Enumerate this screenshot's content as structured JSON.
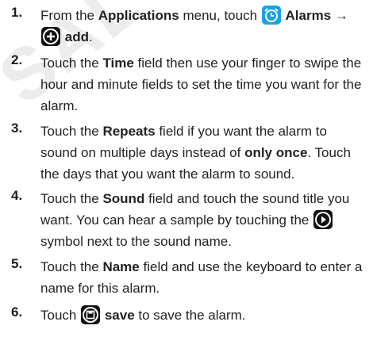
{
  "watermark": "SAL USE ON",
  "steps": [
    {
      "num": "1.",
      "parts": {
        "a": "From the ",
        "b": "Applications",
        "c": " menu, touch ",
        "d": "Alarms →",
        "e": "add",
        "f": "."
      }
    },
    {
      "num": "2.",
      "parts": {
        "a": "Touch the ",
        "b": "Time",
        "c": " field then use your finger to swipe the hour and minute fields to set the time you want for the alarm."
      }
    },
    {
      "num": "3.",
      "parts": {
        "a": "Touch the ",
        "b": "Repeats",
        "c": " field if you want the alarm to sound on multiple days instead of ",
        "d": "only once",
        "e": ". Touch the days that you want the alarm to sound."
      }
    },
    {
      "num": "4.",
      "parts": {
        "a": "Touch the ",
        "b": "Sound",
        "c": " field and touch the sound title you want. You can hear a sample by touching the ",
        "d": "symbol next to the sound name."
      }
    },
    {
      "num": "5.",
      "parts": {
        "a": "Touch the ",
        "b": "Name",
        "c": " field and use the keyboard to enter a name for this alarm."
      }
    },
    {
      "num": "6.",
      "parts": {
        "a": "Touch ",
        "b": "save",
        "c": " to save the alarm."
      }
    }
  ],
  "icons": {
    "alarm": "alarm-clock-icon",
    "add": "add-circle-icon",
    "play": "play-circle-icon",
    "save": "save-disk-icon"
  },
  "colors": {
    "alarm_icon_bg": "#1ba1e2",
    "icon_dark_bg": "#111111",
    "text": "#222222"
  }
}
